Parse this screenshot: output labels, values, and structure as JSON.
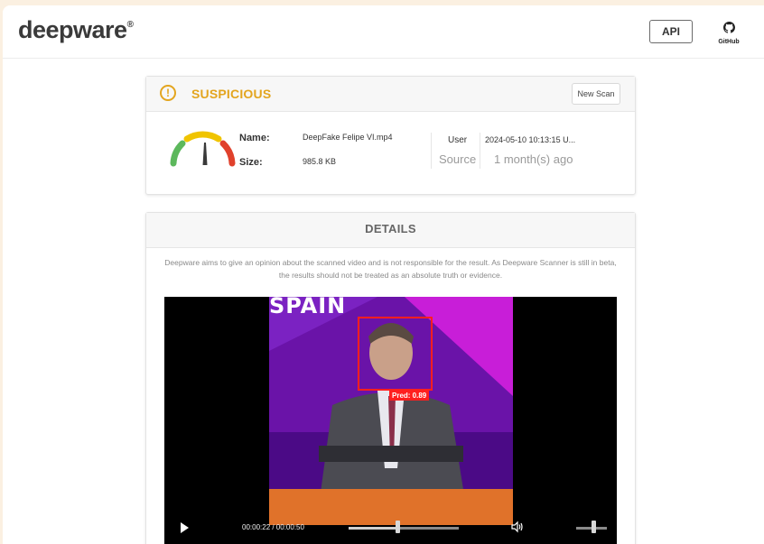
{
  "header": {
    "logo": "deepware",
    "logo_mark": "®",
    "api_label": "API",
    "github_label": "GitHub"
  },
  "result": {
    "status": "SUSPICIOUS",
    "status_color": "#e3a51f",
    "new_scan_label": "New Scan",
    "name_label": "Name:",
    "name_value": "DeepFake Felipe VI.mp4",
    "size_label": "Size:",
    "size_value": "985.8 KB",
    "user_label": "User",
    "user_value": "2024-05-10 10:13:15 U...",
    "source_label": "Source",
    "source_value": "1 month(s) ago"
  },
  "details": {
    "title": "DETAILS",
    "description": "Deepware aims to give an opinion about the scanned video and is not responsible for the result. As Deepware Scanner is still in beta, the results should not be treated as an absolute truth or evidence."
  },
  "video": {
    "overlay_text": "SPAIN",
    "prediction_label": "Pred: 0.89",
    "time": "00:00:22 / 00:00:50",
    "progress": 0.44,
    "volume": 0.55
  },
  "icons": {
    "warning": "warning-circle-icon",
    "github": "github-icon",
    "play": "play-icon",
    "volume": "volume-icon"
  }
}
